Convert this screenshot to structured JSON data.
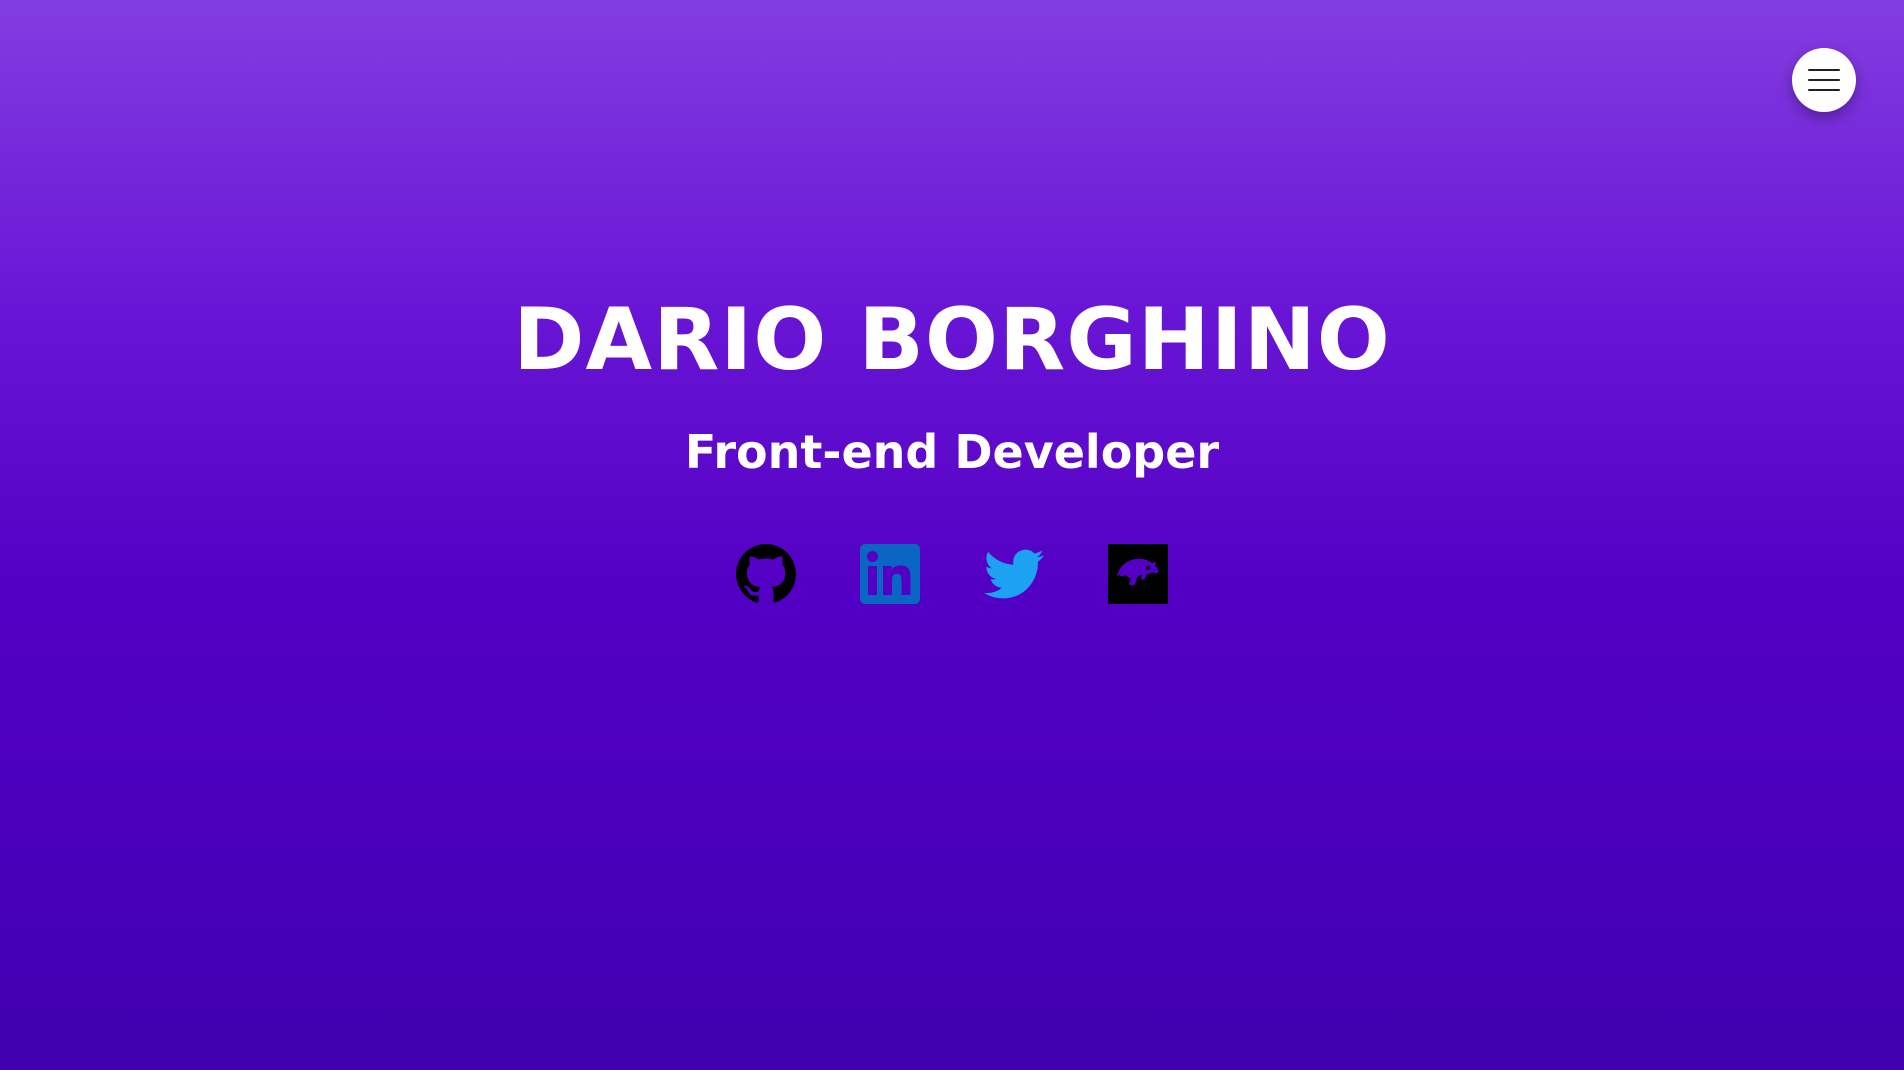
{
  "hero": {
    "name": "DARIO BORGHINO",
    "role": "Front-end Developer"
  },
  "menu": {
    "icon": "hamburger-menu-icon"
  },
  "socials": [
    {
      "icon": "github-icon",
      "color": "#000000"
    },
    {
      "icon": "linkedin-icon",
      "color": "#0a66c2"
    },
    {
      "icon": "twitter-icon",
      "color": "#1da1f2"
    },
    {
      "icon": "codewars-icon",
      "color": "#000000"
    }
  ],
  "colors": {
    "background_top": "#823de0",
    "background_bottom": "#3f00ae",
    "text": "#ffffff",
    "menu_button": "#ffffff"
  }
}
